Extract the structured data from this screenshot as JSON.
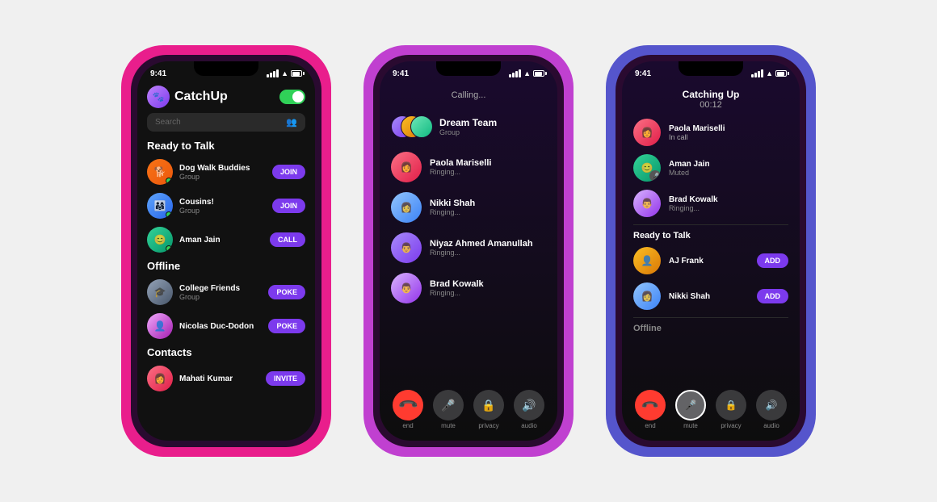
{
  "phone1": {
    "statusBar": {
      "time": "9:41"
    },
    "header": {
      "title": "CatchUp"
    },
    "search": {
      "placeholder": "Search"
    },
    "sections": [
      {
        "title": "Ready to Talk",
        "items": [
          {
            "name": "Dog Walk Buddies",
            "sub": "Group",
            "action": "JOIN",
            "actionType": "join"
          },
          {
            "name": "Cousins!",
            "sub": "Group",
            "action": "JOIN",
            "actionType": "join"
          },
          {
            "name": "Aman Jain",
            "sub": "",
            "action": "CALL",
            "actionType": "call"
          }
        ]
      },
      {
        "title": "Offline",
        "items": [
          {
            "name": "College Friends",
            "sub": "Group",
            "action": "POKE",
            "actionType": "poke"
          },
          {
            "name": "Nicolas Duc-Dodon",
            "sub": "",
            "action": "POKE",
            "actionType": "poke"
          }
        ]
      },
      {
        "title": "Contacts",
        "items": [
          {
            "name": "Mahati Kumar",
            "sub": "",
            "action": "INVITE",
            "actionType": "invite"
          }
        ]
      }
    ]
  },
  "phone2": {
    "statusBar": {
      "time": "9:41"
    },
    "callingLabel": "Calling...",
    "groupName": "Dream Team",
    "groupSub": "Group",
    "callingItems": [
      {
        "name": "Paola Mariselli",
        "status": "Ringing..."
      },
      {
        "name": "Nikki Shah",
        "status": "Ringing..."
      },
      {
        "name": "Niyaz Ahmed Amanullah",
        "status": "Ringing..."
      },
      {
        "name": "Brad Kowalk",
        "status": "Ringing..."
      }
    ],
    "controls": [
      {
        "label": "end",
        "type": "end"
      },
      {
        "label": "mute",
        "type": "mute"
      },
      {
        "label": "privacy",
        "type": "privacy"
      },
      {
        "label": "audio",
        "type": "audio"
      }
    ]
  },
  "phone3": {
    "statusBar": {
      "time": "9:41"
    },
    "title": "Catching Up",
    "timer": "00:12",
    "inCallItems": [
      {
        "name": "Paola Mariselli",
        "status": "In call"
      },
      {
        "name": "Aman Jain",
        "status": "Muted"
      },
      {
        "name": "Brad Kowalk",
        "status": "Ringing..."
      }
    ],
    "readyToTalkSection": "Ready to Talk",
    "readyItems": [
      {
        "name": "AJ Frank",
        "action": "ADD"
      },
      {
        "name": "Nikki Shah",
        "action": "ADD"
      }
    ],
    "offlineSection": "Offline",
    "controls": [
      {
        "label": "end",
        "type": "end"
      },
      {
        "label": "mute",
        "type": "mute-active"
      },
      {
        "label": "privacy",
        "type": "privacy"
      },
      {
        "label": "audio",
        "type": "audio"
      }
    ]
  }
}
